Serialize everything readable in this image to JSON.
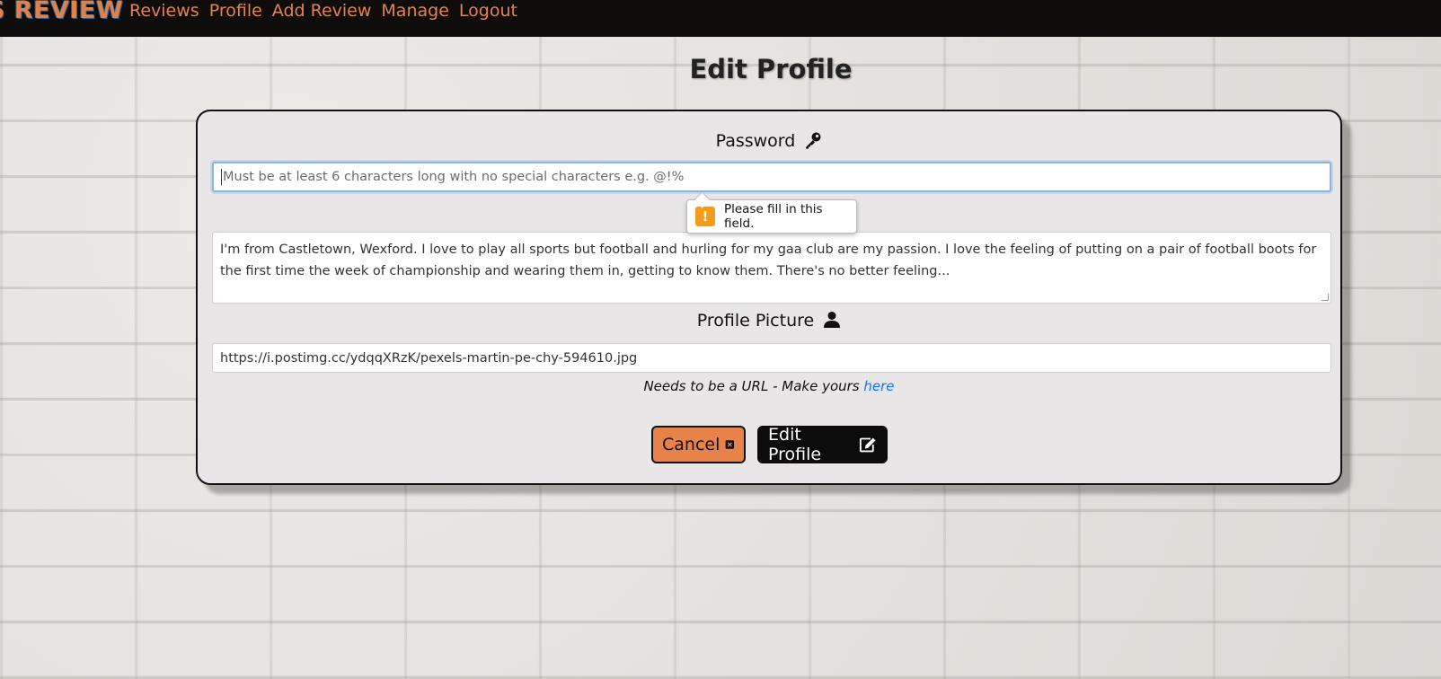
{
  "navbar": {
    "brand": "S REVIEW",
    "links": [
      "Reviews",
      "Profile",
      "Add Review",
      "Manage",
      "Logout"
    ]
  },
  "page": {
    "title": "Edit Profile"
  },
  "form": {
    "password_label": "Password",
    "password_placeholder": "Must be at least 6 characters long with no special characters e.g. @!%",
    "validation_tooltip": "Please fill in this field.",
    "bio_value": "I'm from Castletown, Wexford. I love to play all sports but football and hurling for my gaa club are my passion. I love the feeling of putting on a pair of football boots for the first time the week of championship and wearing them in, getting to know them. There's no better feeling...",
    "picture_label": "Profile Picture",
    "picture_value": "https://i.postimg.cc/ydqqXRzK/pexels-martin-pe-chy-594610.jpg",
    "hint_text": "Needs to be a URL - Make yours",
    "hint_link": "here",
    "cancel_label": "Cancel",
    "submit_label": "Edit Profile"
  },
  "icons": {
    "password": "key-icon",
    "picture": "user-icon",
    "cancel": "close-square-icon",
    "submit": "edit-icon",
    "tooltip": "warning-icon"
  },
  "colors": {
    "accent": "#e8824b",
    "navbar": "#0f0d0c",
    "link": "#1a73e8",
    "warning": "#f39b1b"
  }
}
